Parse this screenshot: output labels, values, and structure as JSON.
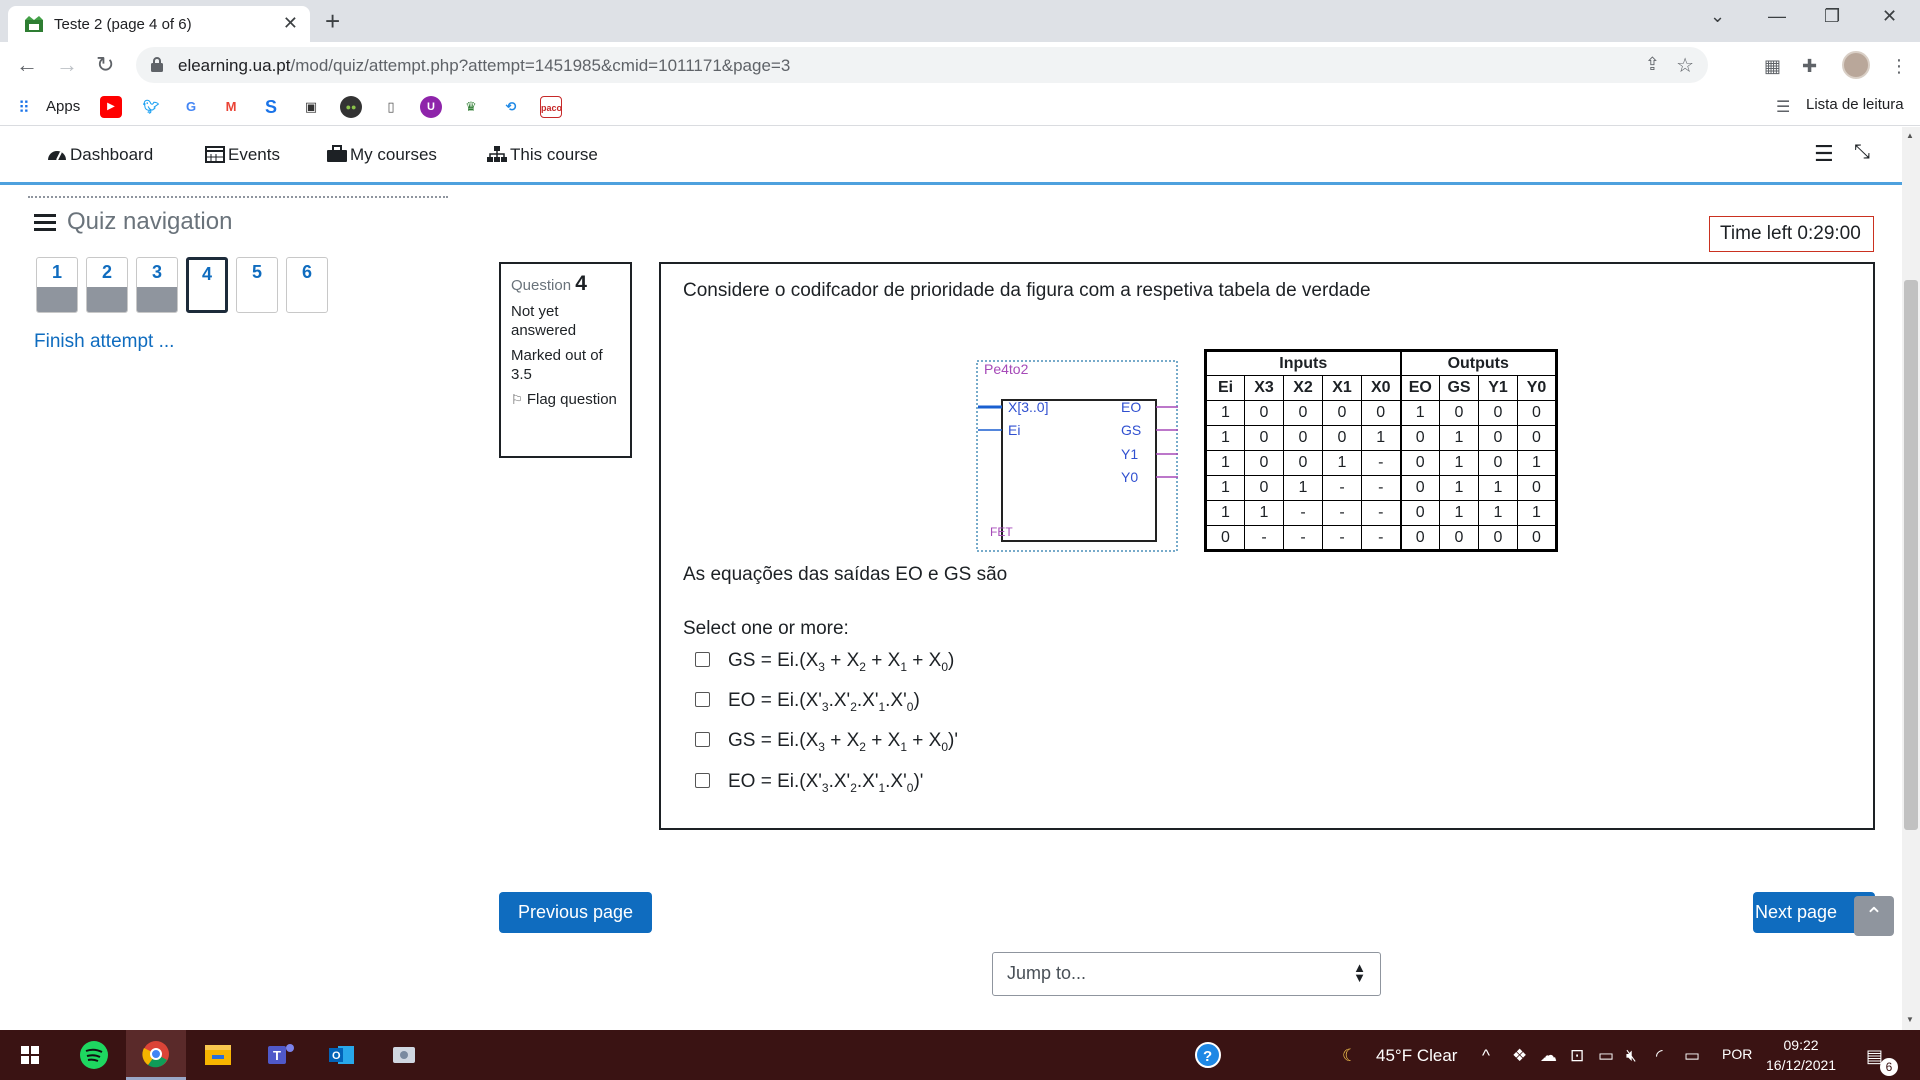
{
  "browser": {
    "tab_title": "Teste 2 (page 4 of 6)",
    "url_host": "elearning.ua.pt",
    "url_path": "/mod/quiz/attempt.php?attempt=1451985&cmid=1011171&page=3",
    "bookmarks_apps_label": "Apps",
    "reading_list_label": "Lista de leitura"
  },
  "moodle_nav": {
    "dashboard": "Dashboard",
    "events": "Events",
    "my_courses": "My courses",
    "this_course": "This course"
  },
  "quiz_nav": {
    "title": "Quiz navigation",
    "buttons": [
      "1",
      "2",
      "3",
      "4",
      "5",
      "6"
    ],
    "answered": [
      true,
      true,
      true,
      false,
      false,
      false
    ],
    "current_index": 3,
    "finish_label": "Finish attempt ..."
  },
  "timer": "Time left 0:29:00",
  "question_info": {
    "label": "Question",
    "number": "4",
    "state": "Not yet answered",
    "marks": "Marked out of 3.5",
    "flag": "Flag question"
  },
  "question": {
    "text": "Considere o codifcador de prioridade da figura com a respetiva tabela de verdade",
    "equations_text": "As equações  das saídas EO e GS são",
    "select_label": "Select one or more:",
    "diagram": {
      "name": "Pe4to2",
      "inputs": [
        "X[3..0]",
        "Ei"
      ],
      "outputs": [
        "EO",
        "GS",
        "Y1",
        "Y0"
      ],
      "footer": "FET"
    },
    "truth_table": {
      "groups": [
        "Inputs",
        "Outputs"
      ],
      "headers": [
        "Ei",
        "X3",
        "X2",
        "X1",
        "X0",
        "EO",
        "GS",
        "Y1",
        "Y0"
      ],
      "rows": [
        [
          "1",
          "0",
          "0",
          "0",
          "0",
          "1",
          "0",
          "0",
          "0"
        ],
        [
          "1",
          "0",
          "0",
          "0",
          "1",
          "0",
          "1",
          "0",
          "0"
        ],
        [
          "1",
          "0",
          "0",
          "1",
          "-",
          "0",
          "1",
          "0",
          "1"
        ],
        [
          "1",
          "0",
          "1",
          "-",
          "-",
          "0",
          "1",
          "1",
          "0"
        ],
        [
          "1",
          "1",
          "-",
          "-",
          "-",
          "0",
          "1",
          "1",
          "1"
        ],
        [
          "0",
          "-",
          "-",
          "-",
          "-",
          "0",
          "0",
          "0",
          "0"
        ]
      ]
    },
    "options": [
      "GS = Ei.(X3 + X2 + X1 + X0)",
      "EO = Ei.(X'3.X'2.X'1.X'0)",
      "GS = Ei.(X3 + X2 + X1 + X0)'",
      "EO = Ei.(X'3.X'2.X'1.X'0)'"
    ]
  },
  "page_nav": {
    "previous": "Previous page",
    "next": "Next page",
    "jump_placeholder": "Jump to..."
  },
  "taskbar": {
    "weather": "45°F  Clear",
    "language": "POR",
    "time": "09:22",
    "date": "16/12/2021",
    "notifications": "6"
  }
}
